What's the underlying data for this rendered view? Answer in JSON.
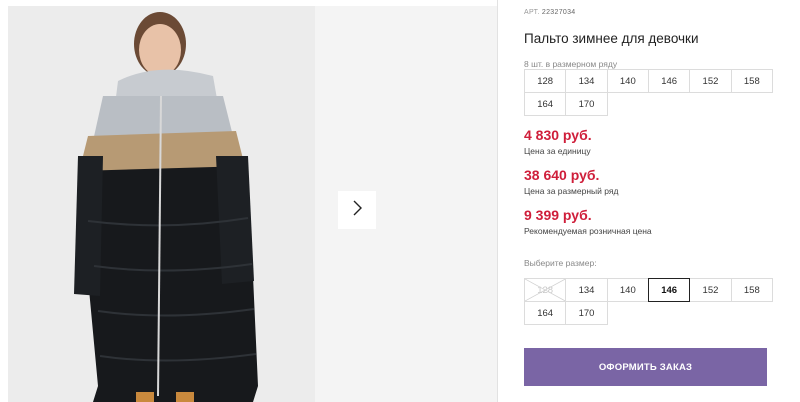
{
  "product": {
    "article_label": "АРТ.",
    "article_number": "22327034",
    "title": "Пальто зимнее для девочки",
    "pack_note": "8 шт. в размерном ряду"
  },
  "size_row": [
    "128",
    "134",
    "140",
    "146",
    "152",
    "158",
    "164",
    "170"
  ],
  "prices": {
    "unit_price": "4 830 руб.",
    "unit_label": "Цена за единицу",
    "row_price": "38 640 руб.",
    "row_label": "Цена за размерный ряд",
    "retail_price": "9 399 руб.",
    "retail_label": "Рекомендуемая розничная цена"
  },
  "size_select": {
    "label": "Выберите размер:",
    "options": [
      "128",
      "134",
      "140",
      "146",
      "152",
      "158",
      "164",
      "170"
    ],
    "selected": "146",
    "unavailable": [
      "128"
    ]
  },
  "order_button": "ОФОРМИТЬ ЗАКАЗ",
  "gallery": {
    "next_icon": "chevron-right-icon"
  },
  "colors": {
    "price": "#cf1e3a",
    "button": "#7a65a5",
    "photo_bg": "#ececec"
  }
}
